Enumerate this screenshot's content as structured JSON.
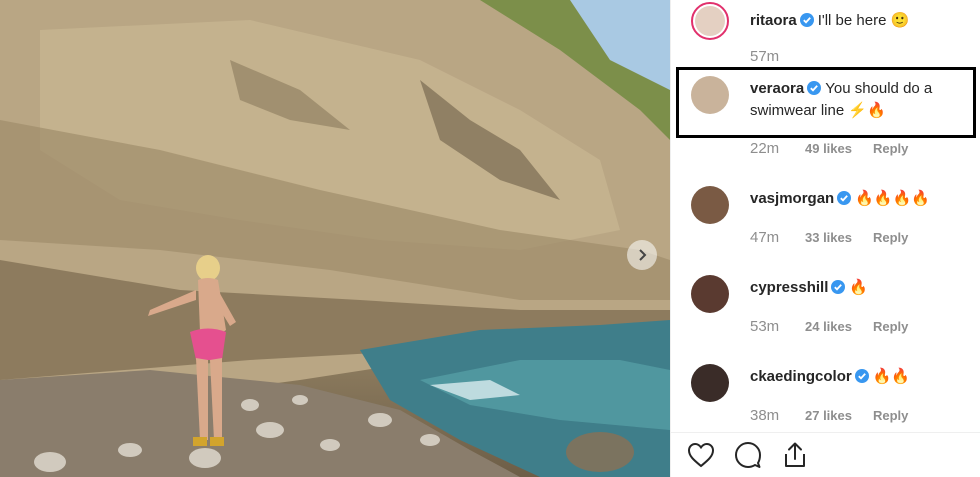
{
  "post": {
    "photo": {
      "description_icon": "beach-photo",
      "next_icon": "chevron-right-icon"
    }
  },
  "comments": [
    {
      "username": "ritaora",
      "verified": true,
      "text": "I'll be here 🙂",
      "time": "57m",
      "likes": "",
      "reply": "",
      "avatar_color": "#e4d0c2"
    },
    {
      "username": "veraora",
      "verified": true,
      "text": "You should do a swimwear line ⚡️🔥",
      "time": "22m",
      "likes": "49 likes",
      "reply": "Reply",
      "avatar_color": "#c9b39b"
    },
    {
      "username": "vasjmorgan",
      "verified": true,
      "text": "🔥🔥🔥🔥",
      "time": "47m",
      "likes": "33 likes",
      "reply": "Reply",
      "avatar_color": "#7a5a44"
    },
    {
      "username": "cypresshill",
      "verified": true,
      "text": "🔥",
      "time": "53m",
      "likes": "24 likes",
      "reply": "Reply",
      "avatar_color": "#5a3a30"
    },
    {
      "username": "ckaedingcolor",
      "verified": true,
      "text": "🔥🔥",
      "time": "38m",
      "likes": "27 likes",
      "reply": "Reply",
      "avatar_color": "#3a2c28"
    }
  ],
  "actions": {
    "like_icon": "heart-icon",
    "comment_icon": "comment-bubble-icon",
    "share_icon": "share-icon"
  },
  "colors": {
    "verified": "#3897f0",
    "text": "#262626",
    "muted": "#8e8e8e",
    "highlight_border": "#000000"
  }
}
